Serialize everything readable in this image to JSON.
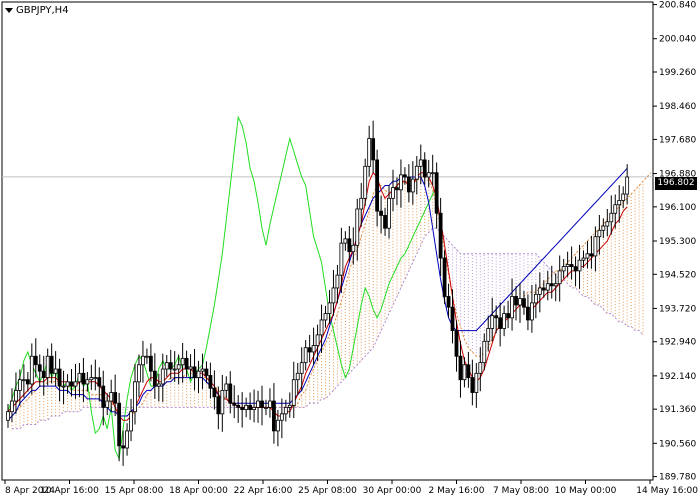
{
  "chart_data": {
    "type": "candlestick",
    "title": "GBPJPY,H4",
    "current_price": "196.802",
    "current_price_value": 196.802,
    "ylim": [
      189.7,
      200.9
    ],
    "y_ticks": [
      "200.840",
      "200.040",
      "199.260",
      "198.460",
      "197.680",
      "196.880",
      "196.100",
      "195.300",
      "194.520",
      "193.720",
      "192.940",
      "192.140",
      "191.360",
      "190.560",
      "189.780"
    ],
    "x_ticks": [
      "8 Apr 2024",
      "10 Apr 16:00",
      "15 Apr 08:00",
      "18 Apr 00:00",
      "22 Apr 16:00",
      "25 Apr 08:00",
      "30 Apr 00:00",
      "2 May 16:00",
      "7 May 08:00",
      "10 May 00:00",
      "14 May 16:00"
    ],
    "grid": false,
    "colors": {
      "bullish_body": "#ffffff",
      "bearish_body": "#000000",
      "tenkan_sen": "#cc0000",
      "kijun_sen": "#0000bb",
      "chikou_span": "#22dd22",
      "senkou_a_cloud": "#e08a3c",
      "senkou_b_cloud": "#b08ad0",
      "price_line": "#c0c0c0"
    },
    "ohlc": {
      "open": [
        191.1,
        191.3,
        191.55,
        191.8,
        192.05,
        192.05,
        191.95,
        192.6,
        192.4,
        192.25,
        192.1,
        192.6,
        192.2,
        192.3,
        191.9,
        191.9,
        192.0,
        191.9,
        192.0,
        192.2,
        191.95,
        192.05,
        192.1,
        192.1,
        191.9,
        191.4,
        191.55,
        191.75,
        191.5,
        190.5,
        190.45,
        190.85,
        191.3,
        192.0,
        192.4,
        192.6,
        192.6,
        192.25,
        191.9,
        191.95,
        192.3,
        192.45,
        192.3,
        192.3,
        192.4,
        192.55,
        192.3,
        192.35,
        192.1,
        192.25,
        192.3,
        192.15,
        191.85,
        191.65,
        191.25,
        191.8,
        191.95,
        191.5,
        191.45,
        191.4,
        191.35,
        191.45,
        191.35,
        191.4,
        191.55,
        191.4,
        191.4,
        191.55,
        190.85,
        191.1,
        191.25,
        191.4,
        191.45,
        192.05,
        192.2,
        192.45,
        192.8,
        192.7,
        192.85,
        193.1,
        193.45,
        193.6,
        193.85,
        194.2,
        194.5,
        195.25,
        195.35,
        195.05,
        195.2,
        196.05,
        196.3,
        197.05,
        197.7,
        197.2,
        196.0,
        195.9,
        195.6,
        196.3,
        196.55,
        196.5,
        196.85,
        196.8,
        196.45,
        196.75,
        197.05,
        197.2,
        196.8,
        196.9,
        196.9,
        195.95,
        194.9,
        194.0,
        193.75,
        193.2,
        192.6,
        192.05,
        192.4,
        192.1,
        191.75,
        192.2,
        192.45,
        192.95,
        193.25,
        193.55,
        193.5,
        193.25,
        193.6,
        193.5,
        194.0,
        193.8,
        193.95,
        193.75,
        193.45,
        193.85,
        194.05,
        194.2,
        194.15,
        194.3,
        194.25,
        194.3,
        194.6,
        194.7,
        194.75,
        194.7,
        194.6,
        194.85,
        194.9,
        195.0,
        194.95,
        195.4,
        195.55,
        195.65,
        195.75,
        195.95,
        196.15,
        196.25,
        196.4
      ],
      "close": [
        191.3,
        191.55,
        191.8,
        192.05,
        192.05,
        191.95,
        192.6,
        192.4,
        192.25,
        192.1,
        192.6,
        192.2,
        192.3,
        191.9,
        191.9,
        192.0,
        191.9,
        192.0,
        192.2,
        191.95,
        192.05,
        192.1,
        192.1,
        191.9,
        191.4,
        191.55,
        191.75,
        191.5,
        190.5,
        190.45,
        190.85,
        191.3,
        192.0,
        192.4,
        192.6,
        192.6,
        192.25,
        191.9,
        191.95,
        192.3,
        192.45,
        192.3,
        192.3,
        192.4,
        192.55,
        192.3,
        192.35,
        192.1,
        192.25,
        192.3,
        192.15,
        191.85,
        191.65,
        191.25,
        191.8,
        191.95,
        191.5,
        191.45,
        191.4,
        191.35,
        191.45,
        191.35,
        191.4,
        191.55,
        191.4,
        191.4,
        191.55,
        190.85,
        191.1,
        191.25,
        191.4,
        191.45,
        192.05,
        192.2,
        192.45,
        192.8,
        192.7,
        192.85,
        193.1,
        193.45,
        193.6,
        193.85,
        194.2,
        194.5,
        195.25,
        195.35,
        195.05,
        195.2,
        196.05,
        196.3,
        197.05,
        197.7,
        197.2,
        196.0,
        195.9,
        195.6,
        196.3,
        196.55,
        196.5,
        196.85,
        196.8,
        196.45,
        196.75,
        197.05,
        197.2,
        196.8,
        196.9,
        196.9,
        195.95,
        194.9,
        194.0,
        193.75,
        193.2,
        192.6,
        192.05,
        192.4,
        192.1,
        191.75,
        192.2,
        192.45,
        192.95,
        193.25,
        193.55,
        193.5,
        193.25,
        193.6,
        193.5,
        194.0,
        193.8,
        193.95,
        193.75,
        193.45,
        193.85,
        194.05,
        194.2,
        194.15,
        194.3,
        194.25,
        194.3,
        194.6,
        194.7,
        194.75,
        194.7,
        194.6,
        194.85,
        194.9,
        195.0,
        194.95,
        195.4,
        195.55,
        195.65,
        195.75,
        195.95,
        196.15,
        196.25,
        196.4,
        196.8
      ]
    },
    "tenkan_sen": [
      191.3,
      191.4,
      191.5,
      191.6,
      191.7,
      191.8,
      191.9,
      192.0,
      192.0,
      192.0,
      192.1,
      192.1,
      192.1,
      192.0,
      192.0,
      192.0,
      191.9,
      191.9,
      192.0,
      192.0,
      192.0,
      192.0,
      192.0,
      191.9,
      191.8,
      191.7,
      191.6,
      191.4,
      191.2,
      191.1,
      191.1,
      191.2,
      191.4,
      191.6,
      191.8,
      192.0,
      192.1,
      192.1,
      192.0,
      192.0,
      192.1,
      192.2,
      192.2,
      192.2,
      192.3,
      192.3,
      192.3,
      192.2,
      192.2,
      192.2,
      192.1,
      192.0,
      191.9,
      191.7,
      191.6,
      191.6,
      191.5,
      191.5,
      191.4,
      191.4,
      191.4,
      191.4,
      191.4,
      191.4,
      191.4,
      191.4,
      191.4,
      191.3,
      191.2,
      191.2,
      191.3,
      191.3,
      191.5,
      191.7,
      191.9,
      192.2,
      192.4,
      192.6,
      192.8,
      193.0,
      193.2,
      193.4,
      193.6,
      193.9,
      194.3,
      194.7,
      194.9,
      195.1,
      195.4,
      195.7,
      196.2,
      196.7,
      196.9,
      196.8,
      196.5,
      196.3,
      196.4,
      196.5,
      196.6,
      196.7,
      196.7,
      196.6,
      196.6,
      196.8,
      196.9,
      196.9,
      196.8,
      196.6,
      196.3,
      195.8,
      195.2,
      194.6,
      194.0,
      193.4,
      192.9,
      192.5,
      192.3,
      192.1,
      192.0,
      192.1,
      192.3,
      192.6,
      192.9,
      193.2,
      193.3,
      193.4,
      193.5,
      193.6,
      193.7,
      193.8,
      193.8,
      193.7,
      193.7,
      193.8,
      193.9,
      194.0,
      194.1,
      194.1,
      194.2,
      194.3,
      194.4,
      194.5,
      194.6,
      194.6,
      194.7,
      194.7,
      194.8,
      194.9,
      195.0,
      195.1,
      195.2,
      195.3,
      195.5,
      195.7,
      195.8,
      196.0,
      196.1
    ],
    "kijun_sen": [
      191.1,
      191.2,
      191.3,
      191.5,
      191.6,
      191.7,
      191.8,
      191.8,
      191.9,
      191.9,
      191.9,
      191.9,
      191.9,
      191.8,
      191.8,
      191.8,
      191.7,
      191.7,
      191.7,
      191.7,
      191.6,
      191.6,
      191.6,
      191.6,
      191.5,
      191.4,
      191.3,
      191.3,
      191.2,
      191.2,
      191.2,
      191.3,
      191.4,
      191.5,
      191.7,
      191.8,
      191.8,
      191.9,
      191.9,
      191.9,
      192.0,
      192.0,
      192.1,
      192.1,
      192.1,
      192.1,
      192.1,
      192.1,
      192.1,
      192.1,
      192.0,
      191.9,
      191.8,
      191.7,
      191.6,
      191.6,
      191.5,
      191.5,
      191.5,
      191.5,
      191.5,
      191.5,
      191.5,
      191.5,
      191.5,
      191.5,
      191.5,
      191.5,
      191.5,
      191.5,
      191.5,
      191.5,
      191.6,
      191.7,
      191.8,
      192.0,
      192.2,
      192.4,
      192.6,
      192.8,
      193.0,
      193.3,
      193.6,
      193.9,
      194.2,
      194.5,
      194.8,
      195.1,
      195.4,
      195.7,
      195.9,
      196.1,
      196.3,
      196.4,
      196.5,
      196.6,
      196.6,
      196.7,
      196.7,
      196.8,
      196.8,
      196.8,
      196.8,
      196.8,
      196.8,
      196.6,
      196.2,
      195.6,
      195.0,
      194.4,
      193.9,
      193.5,
      193.3,
      193.2,
      193.2,
      193.2,
      193.2,
      193.2,
      193.2,
      193.3,
      193.4,
      193.5,
      193.6,
      193.7,
      193.8,
      193.9,
      194.0,
      194.1,
      194.2,
      194.3,
      194.4,
      194.5,
      194.6,
      194.7,
      194.8,
      194.9,
      195.0,
      195.1,
      195.2,
      195.3,
      195.4,
      195.5,
      195.6,
      195.7,
      195.8,
      195.9,
      196.0,
      196.1,
      196.2,
      196.3,
      196.4,
      196.5,
      196.6,
      196.7,
      196.8,
      196.9,
      197.0
    ],
    "chikou_span": [
      191.3,
      191.6,
      191.9,
      192.1,
      192.5,
      192.7,
      192.4,
      192.2,
      192.0,
      192.2,
      192.5,
      192.1,
      192.3,
      191.9,
      191.9,
      192.0,
      191.8,
      191.9,
      192.2,
      191.9,
      192.0,
      191.3,
      190.8,
      190.9,
      191.2,
      190.9,
      191.4,
      190.4,
      190.2,
      190.9,
      191.6,
      192.1,
      192.4,
      192.6,
      192.5,
      192.2,
      191.9,
      191.9,
      192.3,
      192.5,
      192.3,
      192.3,
      192.4,
      192.6,
      192.3,
      192.3,
      192.0,
      192.2,
      192.3,
      192.4,
      192.8,
      193.3,
      193.8,
      194.4,
      195.0,
      195.8,
      196.6,
      197.4,
      198.2,
      198.0,
      197.6,
      197.0,
      196.7,
      196.2,
      195.6,
      195.2,
      195.7,
      196.1,
      196.5,
      196.9,
      197.3,
      197.7,
      197.4,
      197.1,
      196.8,
      196.6,
      196.0,
      195.4,
      195.1,
      194.8,
      194.2,
      193.6,
      193.2,
      192.8,
      192.4,
      192.1,
      192.3,
      192.8,
      193.3,
      193.8,
      194.2,
      194.0,
      193.7,
      193.5,
      193.7,
      194.0,
      194.3,
      194.5,
      194.7,
      194.9,
      195.0,
      195.2,
      195.4,
      195.6,
      195.8,
      196.0,
      196.2,
      196.4,
      196.6
    ],
    "senkou_a": [
      191.2,
      191.3,
      191.4,
      191.5,
      191.6,
      191.7,
      191.8,
      191.9,
      191.9,
      192.0,
      192.0,
      192.0,
      192.0,
      191.9,
      191.9,
      191.8,
      191.8,
      191.8,
      191.8,
      191.8,
      191.7,
      191.7,
      191.7,
      191.7,
      191.6,
      191.5,
      191.4,
      191.3,
      191.2,
      191.2,
      191.2,
      191.3,
      191.4,
      191.5,
      191.7,
      191.8,
      191.9,
      192.0,
      192.0,
      192.0,
      192.1,
      192.1,
      192.1,
      192.1,
      192.2,
      192.2,
      192.2,
      192.1,
      192.1,
      192.1,
      192.0,
      191.9,
      191.8,
      191.7,
      191.6,
      191.6,
      191.5,
      191.5,
      191.5,
      191.4,
      191.4,
      191.4,
      191.4,
      191.4,
      191.4,
      191.4,
      191.4,
      191.4,
      191.4,
      191.4,
      191.4,
      191.4,
      191.5,
      191.7,
      191.8,
      192.1,
      192.3,
      192.5,
      192.7,
      192.9,
      193.1,
      193.3,
      193.6,
      193.9,
      194.2,
      194.6,
      194.9,
      195.1,
      195.4,
      195.7,
      196.0,
      196.4,
      196.6,
      196.6,
      196.5,
      196.4,
      196.5,
      196.6,
      196.6,
      196.7,
      196.7,
      196.7,
      196.7,
      196.8,
      196.8,
      196.7,
      196.5,
      196.1,
      195.6,
      195.1,
      194.5,
      194.0,
      193.6,
      193.3,
      193.0,
      192.8,
      192.7,
      192.6,
      192.6,
      192.7,
      192.8,
      193.0,
      193.2,
      193.4,
      193.5,
      193.6,
      193.7,
      193.8,
      193.9,
      194.0,
      194.1,
      194.1,
      194.1,
      194.2,
      194.3,
      194.4,
      194.5,
      194.6,
      194.6,
      194.7,
      194.8,
      194.9,
      195.0,
      195.1,
      195.2,
      195.3,
      195.4,
      195.5,
      195.6,
      195.7,
      195.8,
      195.9,
      196.0,
      196.1,
      196.2,
      196.3,
      196.4,
      196.5,
      196.6,
      196.7,
      196.8,
      196.9
    ],
    "senkou_b": [
      190.9,
      190.9,
      190.9,
      191.0,
      191.0,
      191.0,
      191.0,
      191.1,
      191.1,
      191.1,
      191.2,
      191.2,
      191.2,
      191.3,
      191.3,
      191.3,
      191.3,
      191.3,
      191.4,
      191.4,
      191.4,
      191.4,
      191.4,
      191.4,
      191.4,
      191.4,
      191.4,
      191.4,
      191.4,
      191.4,
      191.4,
      191.4,
      191.4,
      191.4,
      191.4,
      191.4,
      191.4,
      191.4,
      191.4,
      191.4,
      191.4,
      191.4,
      191.4,
      191.4,
      191.4,
      191.4,
      191.4,
      191.4,
      191.4,
      191.4,
      191.4,
      191.4,
      191.4,
      191.4,
      191.4,
      191.4,
      191.4,
      191.4,
      191.4,
      191.4,
      191.4,
      191.4,
      191.4,
      191.4,
      191.4,
      191.4,
      191.4,
      191.4,
      191.4,
      191.4,
      191.4,
      191.4,
      191.4,
      191.4,
      191.4,
      191.5,
      191.5,
      191.5,
      191.6,
      191.6,
      191.7,
      191.8,
      191.9,
      192.0,
      192.1,
      192.2,
      192.3,
      192.4,
      192.5,
      192.6,
      192.7,
      192.8,
      193.0,
      193.2,
      193.4,
      193.6,
      193.8,
      194.0,
      194.2,
      194.4,
      194.6,
      194.8,
      195.0,
      195.2,
      195.4,
      195.5,
      195.6,
      195.6,
      195.5,
      195.4,
      195.3,
      195.2,
      195.1,
      195.0,
      195.0,
      195.0,
      195.0,
      195.0,
      195.0,
      195.0,
      195.0,
      195.0,
      195.0,
      195.0,
      195.0,
      195.0,
      195.0,
      195.0,
      195.0,
      195.0,
      195.0,
      195.0,
      195.0,
      194.9,
      194.8,
      194.7,
      194.6,
      194.5,
      194.4,
      194.4,
      194.3,
      194.2,
      194.2,
      194.1,
      194.0,
      194.0,
      193.9,
      193.8,
      193.8,
      193.7,
      193.6,
      193.6,
      193.5,
      193.4,
      193.4,
      193.3,
      193.3,
      193.2,
      193.2,
      193.1
    ]
  }
}
